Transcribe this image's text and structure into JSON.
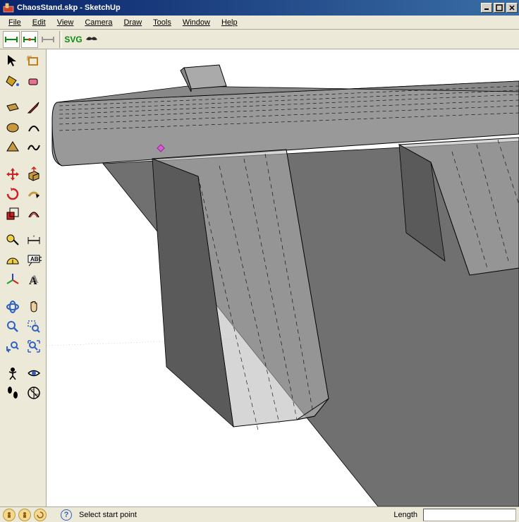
{
  "title": "ChaosStand.skp - SketchUp",
  "menu": [
    "File",
    "Edit",
    "View",
    "Camera",
    "Draw",
    "Tools",
    "Window",
    "Help"
  ],
  "toolbar_svg_label": "SVG",
  "status": {
    "hint": "Select start point",
    "field_label": "Length",
    "field_value": ""
  },
  "icons": {
    "select": "select-arrow",
    "component": "component",
    "paint": "paint-bucket",
    "eraser": "eraser",
    "rectangle": "rectangle",
    "line": "line-pencil",
    "circle": "circle",
    "arc": "arc",
    "polygon": "polygon",
    "freehand": "freehand",
    "move": "move",
    "pushpull": "push-pull",
    "rotate": "rotate",
    "followme": "follow-me",
    "scale": "scale",
    "offset": "offset",
    "tape": "tape-measure",
    "dimension": "dimension",
    "protractor": "protractor",
    "text": "text-label",
    "axes": "axes",
    "text3d": "3d-text",
    "orbit": "orbit",
    "pan": "pan-hand",
    "zoom": "zoom",
    "zoomwindow": "zoom-window",
    "previous": "previous-view",
    "zoomextents": "zoom-extents",
    "camera": "position-camera",
    "lookaround": "look-around",
    "walk": "walk",
    "section": "section-plane"
  }
}
